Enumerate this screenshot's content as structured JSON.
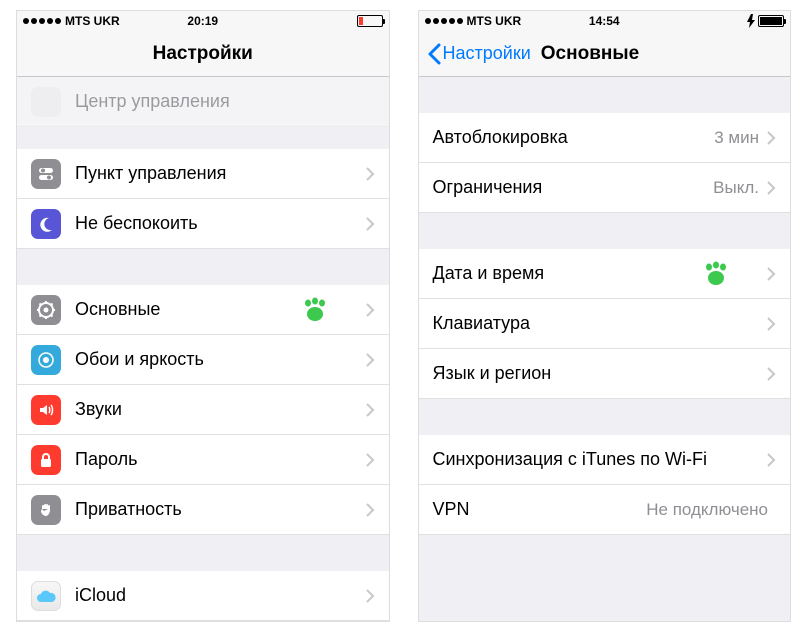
{
  "left": {
    "carrier": "MTS UKR",
    "time": "20:19",
    "title": "Настройки",
    "faded_label": "Центр управления",
    "rows_g1": [
      {
        "label": "Пункт управления"
      },
      {
        "label": "Не беспокоить"
      }
    ],
    "rows_g2": [
      {
        "label": "Основные"
      },
      {
        "label": "Обои и яркость"
      },
      {
        "label": "Звуки"
      },
      {
        "label": "Пароль"
      },
      {
        "label": "Приватность"
      }
    ],
    "rows_g3": [
      {
        "label": "iCloud"
      }
    ]
  },
  "right": {
    "carrier": "MTS UKR",
    "time": "14:54",
    "back": "Настройки",
    "title": "Основные",
    "rows_g1": [
      {
        "label": "Автоблокировка",
        "value": "3 мин"
      },
      {
        "label": "Ограничения",
        "value": "Выкл."
      }
    ],
    "rows_g2": [
      {
        "label": "Дата и время"
      },
      {
        "label": "Клавиатура"
      },
      {
        "label": "Язык и регион"
      }
    ],
    "rows_g3": [
      {
        "label": "Синхронизация с iTunes по Wi-Fi"
      },
      {
        "label": "VPN",
        "value": "Не подключено"
      }
    ]
  }
}
